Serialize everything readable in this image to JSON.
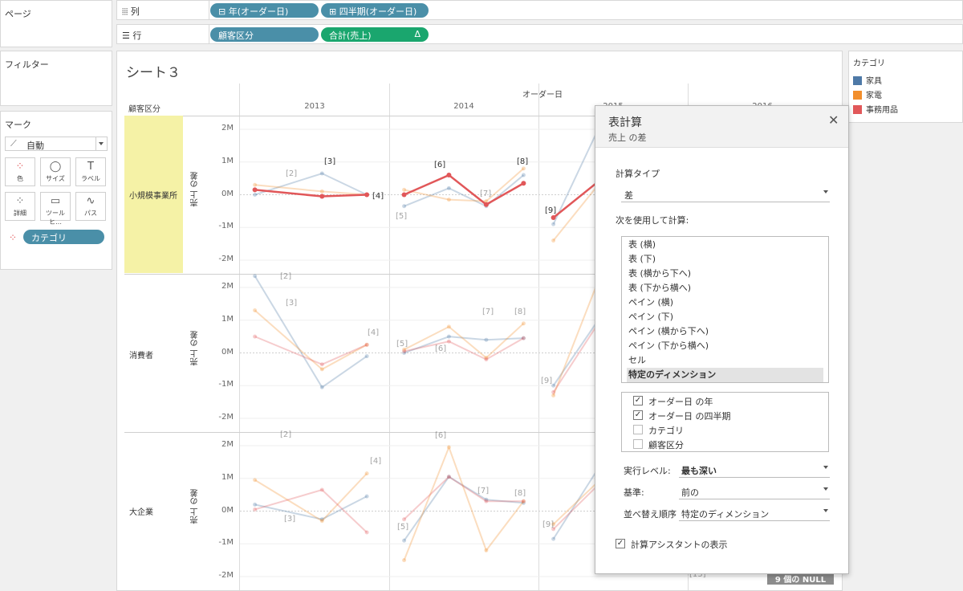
{
  "left": {
    "pages_title": "ページ",
    "filters_title": "フィルター",
    "marks_title": "マーク",
    "mark_type": "自動",
    "mark_buttons": [
      {
        "label": "色",
        "icon": "color-icon"
      },
      {
        "label": "サイズ",
        "icon": "size-icon"
      },
      {
        "label": "ラベル",
        "icon": "label-icon"
      },
      {
        "label": "詳細",
        "icon": "detail-icon"
      },
      {
        "label": "ツールヒ…",
        "icon": "tooltip-icon"
      },
      {
        "label": "パス",
        "icon": "path-icon"
      }
    ],
    "mark_field": "カテゴリ"
  },
  "shelves": {
    "columns_label": "列",
    "columns_pills": [
      "年(オーダー日)",
      "四半期(オーダー日)"
    ],
    "rows_label": "行",
    "rows_pills": [
      "顧客区分",
      "合計(売上)"
    ],
    "delta_glyph": "Δ"
  },
  "view": {
    "title": "シート３",
    "top_header": "オーダー日",
    "row_header": "顧客区分",
    "years": [
      "2013",
      "2014",
      "2015",
      "2016"
    ],
    "segments": [
      "小規模事業所",
      "消費者",
      "大企業"
    ],
    "axis_label": "売上 の差",
    "ticks": [
      "2M",
      "1M",
      "0M",
      "-1M",
      "-2M"
    ],
    "null_badge": "9 個の NULL"
  },
  "legend": {
    "title": "カテゴリ",
    "items": [
      {
        "label": "家具",
        "color": "#4e79a7"
      },
      {
        "label": "家電",
        "color": "#f28e2b"
      },
      {
        "label": "事務用品",
        "color": "#e15759"
      }
    ]
  },
  "dialog": {
    "title": "表計算",
    "subtitle": "売上 の差",
    "calc_type_label": "計算タイプ",
    "calc_type_value": "差",
    "compute_using_label": "次を使用して計算:",
    "compute_options": [
      "表 (横)",
      "表 (下)",
      "表 (横から下へ)",
      "表 (下から横へ)",
      "ペイン (横)",
      "ペイン (下)",
      "ペイン (横から下へ)",
      "ペイン (下から横へ)",
      "セル",
      "特定のディメンション"
    ],
    "selected_option": "特定のディメンション",
    "dimensions": [
      {
        "label": "オーダー日 の年",
        "checked": true
      },
      {
        "label": "オーダー日 の四半期",
        "checked": true
      },
      {
        "label": "カテゴリ",
        "checked": false
      },
      {
        "label": "顧客区分",
        "checked": false
      }
    ],
    "level_label": "実行レベル:",
    "level_value": "最も深い",
    "relative_label": "基準:",
    "relative_value": "前の",
    "sort_label": "並べ替え順序",
    "sort_value": "特定のディメンション",
    "assistant_label": "計算アシスタントの表示",
    "assistant_checked": true
  },
  "chart_data": {
    "type": "line",
    "ylim": [
      -2000000,
      2000000
    ],
    "panes": [
      {
        "segment": "小規模事業所",
        "series": [
          {
            "name": "家具",
            "points": [
              [
                "2013",
                0.1,
                0.0
              ],
              [
                "2013",
                0.55,
                0.65
              ],
              [
                "2013",
                0.85,
                0.0
              ],
              [
                "2014",
                0.1,
                -0.35
              ],
              [
                "2014",
                0.4,
                0.2
              ],
              [
                "2014",
                0.65,
                -0.35
              ],
              [
                "2014",
                0.9,
                0.6
              ],
              [
                "2015",
                0.1,
                -0.9
              ],
              [
                "2015",
                0.4,
                2.0
              ]
            ]
          },
          {
            "name": "家電",
            "points": [
              [
                "2013",
                0.1,
                0.3
              ],
              [
                "2013",
                0.55,
                0.1
              ],
              [
                "2013",
                0.85,
                0.0
              ],
              [
                "2014",
                0.1,
                0.15
              ],
              [
                "2014",
                0.4,
                -0.15
              ],
              [
                "2014",
                0.65,
                -0.2
              ],
              [
                "2014",
                0.9,
                0.8
              ],
              [
                "2015",
                0.1,
                -1.4
              ],
              [
                "2015",
                0.4,
                0.3
              ]
            ]
          },
          {
            "name": "事務用品",
            "points": [
              [
                "2013",
                0.1,
                0.15
              ],
              [
                "2013",
                0.55,
                -0.05
              ],
              [
                "2013",
                0.85,
                0.0
              ],
              [
                "2014",
                0.1,
                0.0
              ],
              [
                "2014",
                0.4,
                0.6
              ],
              [
                "2014",
                0.65,
                -0.3
              ],
              [
                "2014",
                0.9,
                0.35
              ],
              [
                "2015",
                0.1,
                -0.7
              ],
              [
                "2015",
                0.4,
                0.4
              ]
            ]
          }
        ]
      },
      {
        "segment": "消費者",
        "series": [
          {
            "name": "家具",
            "points": [
              [
                "2013",
                0.1,
                2.35
              ],
              [
                "2013",
                0.55,
                -1.05
              ],
              [
                "2013",
                0.85,
                -0.1
              ],
              [
                "2014",
                0.1,
                0.0
              ],
              [
                "2014",
                0.4,
                0.5
              ],
              [
                "2014",
                0.65,
                0.4
              ],
              [
                "2014",
                0.9,
                0.45
              ],
              [
                "2015",
                0.1,
                -1.0
              ],
              [
                "2015",
                0.4,
                1.0
              ]
            ]
          },
          {
            "name": "家電",
            "points": [
              [
                "2013",
                0.1,
                1.3
              ],
              [
                "2013",
                0.55,
                -0.5
              ],
              [
                "2013",
                0.85,
                0.25
              ],
              [
                "2014",
                0.1,
                0.1
              ],
              [
                "2014",
                0.4,
                0.8
              ],
              [
                "2014",
                0.65,
                -0.15
              ],
              [
                "2014",
                0.9,
                0.9
              ],
              [
                "2015",
                0.1,
                -1.3
              ],
              [
                "2015",
                0.4,
                2.2
              ]
            ]
          },
          {
            "name": "事務用品",
            "points": [
              [
                "2013",
                0.1,
                0.5
              ],
              [
                "2013",
                0.55,
                -0.35
              ],
              [
                "2013",
                0.85,
                0.25
              ],
              [
                "2014",
                0.1,
                0.05
              ],
              [
                "2014",
                0.4,
                0.35
              ],
              [
                "2014",
                0.65,
                -0.2
              ],
              [
                "2014",
                0.9,
                0.45
              ],
              [
                "2015",
                0.1,
                -1.2
              ],
              [
                "2015",
                0.4,
                0.9
              ]
            ]
          }
        ]
      },
      {
        "segment": "大企業",
        "series": [
          {
            "name": "家具",
            "points": [
              [
                "2013",
                0.1,
                0.2
              ],
              [
                "2013",
                0.55,
                -0.25
              ],
              [
                "2013",
                0.85,
                0.45
              ],
              [
                "2014",
                0.1,
                -0.9
              ],
              [
                "2014",
                0.4,
                1.05
              ],
              [
                "2014",
                0.65,
                0.35
              ],
              [
                "2014",
                0.9,
                0.25
              ],
              [
                "2015",
                0.1,
                -0.85
              ],
              [
                "2015",
                0.4,
                1.3
              ]
            ]
          },
          {
            "name": "家電",
            "points": [
              [
                "2013",
                0.1,
                0.95
              ],
              [
                "2013",
                0.55,
                -0.3
              ],
              [
                "2013",
                0.85,
                1.15
              ],
              [
                "2014",
                0.1,
                -1.5
              ],
              [
                "2014",
                0.4,
                1.95
              ],
              [
                "2014",
                0.65,
                -1.2
              ],
              [
                "2014",
                0.9,
                0.3
              ],
              [
                "2015",
                0.1,
                -0.4
              ],
              [
                "2015",
                0.4,
                0.9
              ]
            ]
          },
          {
            "name": "事務用品",
            "points": [
              [
                "2013",
                0.1,
                0.05
              ],
              [
                "2013",
                0.55,
                0.65
              ],
              [
                "2013",
                0.85,
                -0.65
              ],
              [
                "2014",
                0.1,
                -0.25
              ],
              [
                "2014",
                0.4,
                1.05
              ],
              [
                "2014",
                0.65,
                0.3
              ],
              [
                "2014",
                0.9,
                0.3
              ],
              [
                "2015",
                0.1,
                -0.55
              ],
              [
                "2015",
                0.4,
                0.8
              ]
            ]
          }
        ]
      }
    ],
    "point_labels": [
      {
        "pane": 0,
        "text": "[2]"
      },
      {
        "pane": 0,
        "text": "[3]"
      },
      {
        "pane": 0,
        "text": "[4]"
      },
      {
        "pane": 0,
        "text": "[5]"
      },
      {
        "pane": 0,
        "text": "[6]"
      },
      {
        "pane": 0,
        "text": "[7]"
      },
      {
        "pane": 0,
        "text": "[8]"
      },
      {
        "pane": 0,
        "text": "[9]"
      },
      {
        "pane": 1,
        "text": "[2]"
      },
      {
        "pane": 1,
        "text": "[3]"
      },
      {
        "pane": 1,
        "text": "[4]"
      },
      {
        "pane": 1,
        "text": "[5]"
      },
      {
        "pane": 1,
        "text": "[6]"
      },
      {
        "pane": 1,
        "text": "[7]"
      },
      {
        "pane": 1,
        "text": "[8]"
      },
      {
        "pane": 1,
        "text": "[9]"
      },
      {
        "pane": 2,
        "text": "[2]"
      },
      {
        "pane": 2,
        "text": "[3]"
      },
      {
        "pane": 2,
        "text": "[4]"
      },
      {
        "pane": 2,
        "text": "[5]"
      },
      {
        "pane": 2,
        "text": "[6]"
      },
      {
        "pane": 2,
        "text": "[7]"
      },
      {
        "pane": 2,
        "text": "[8]"
      },
      {
        "pane": 2,
        "text": "[9]"
      },
      {
        "pane": 2,
        "text": "[13]"
      }
    ]
  }
}
